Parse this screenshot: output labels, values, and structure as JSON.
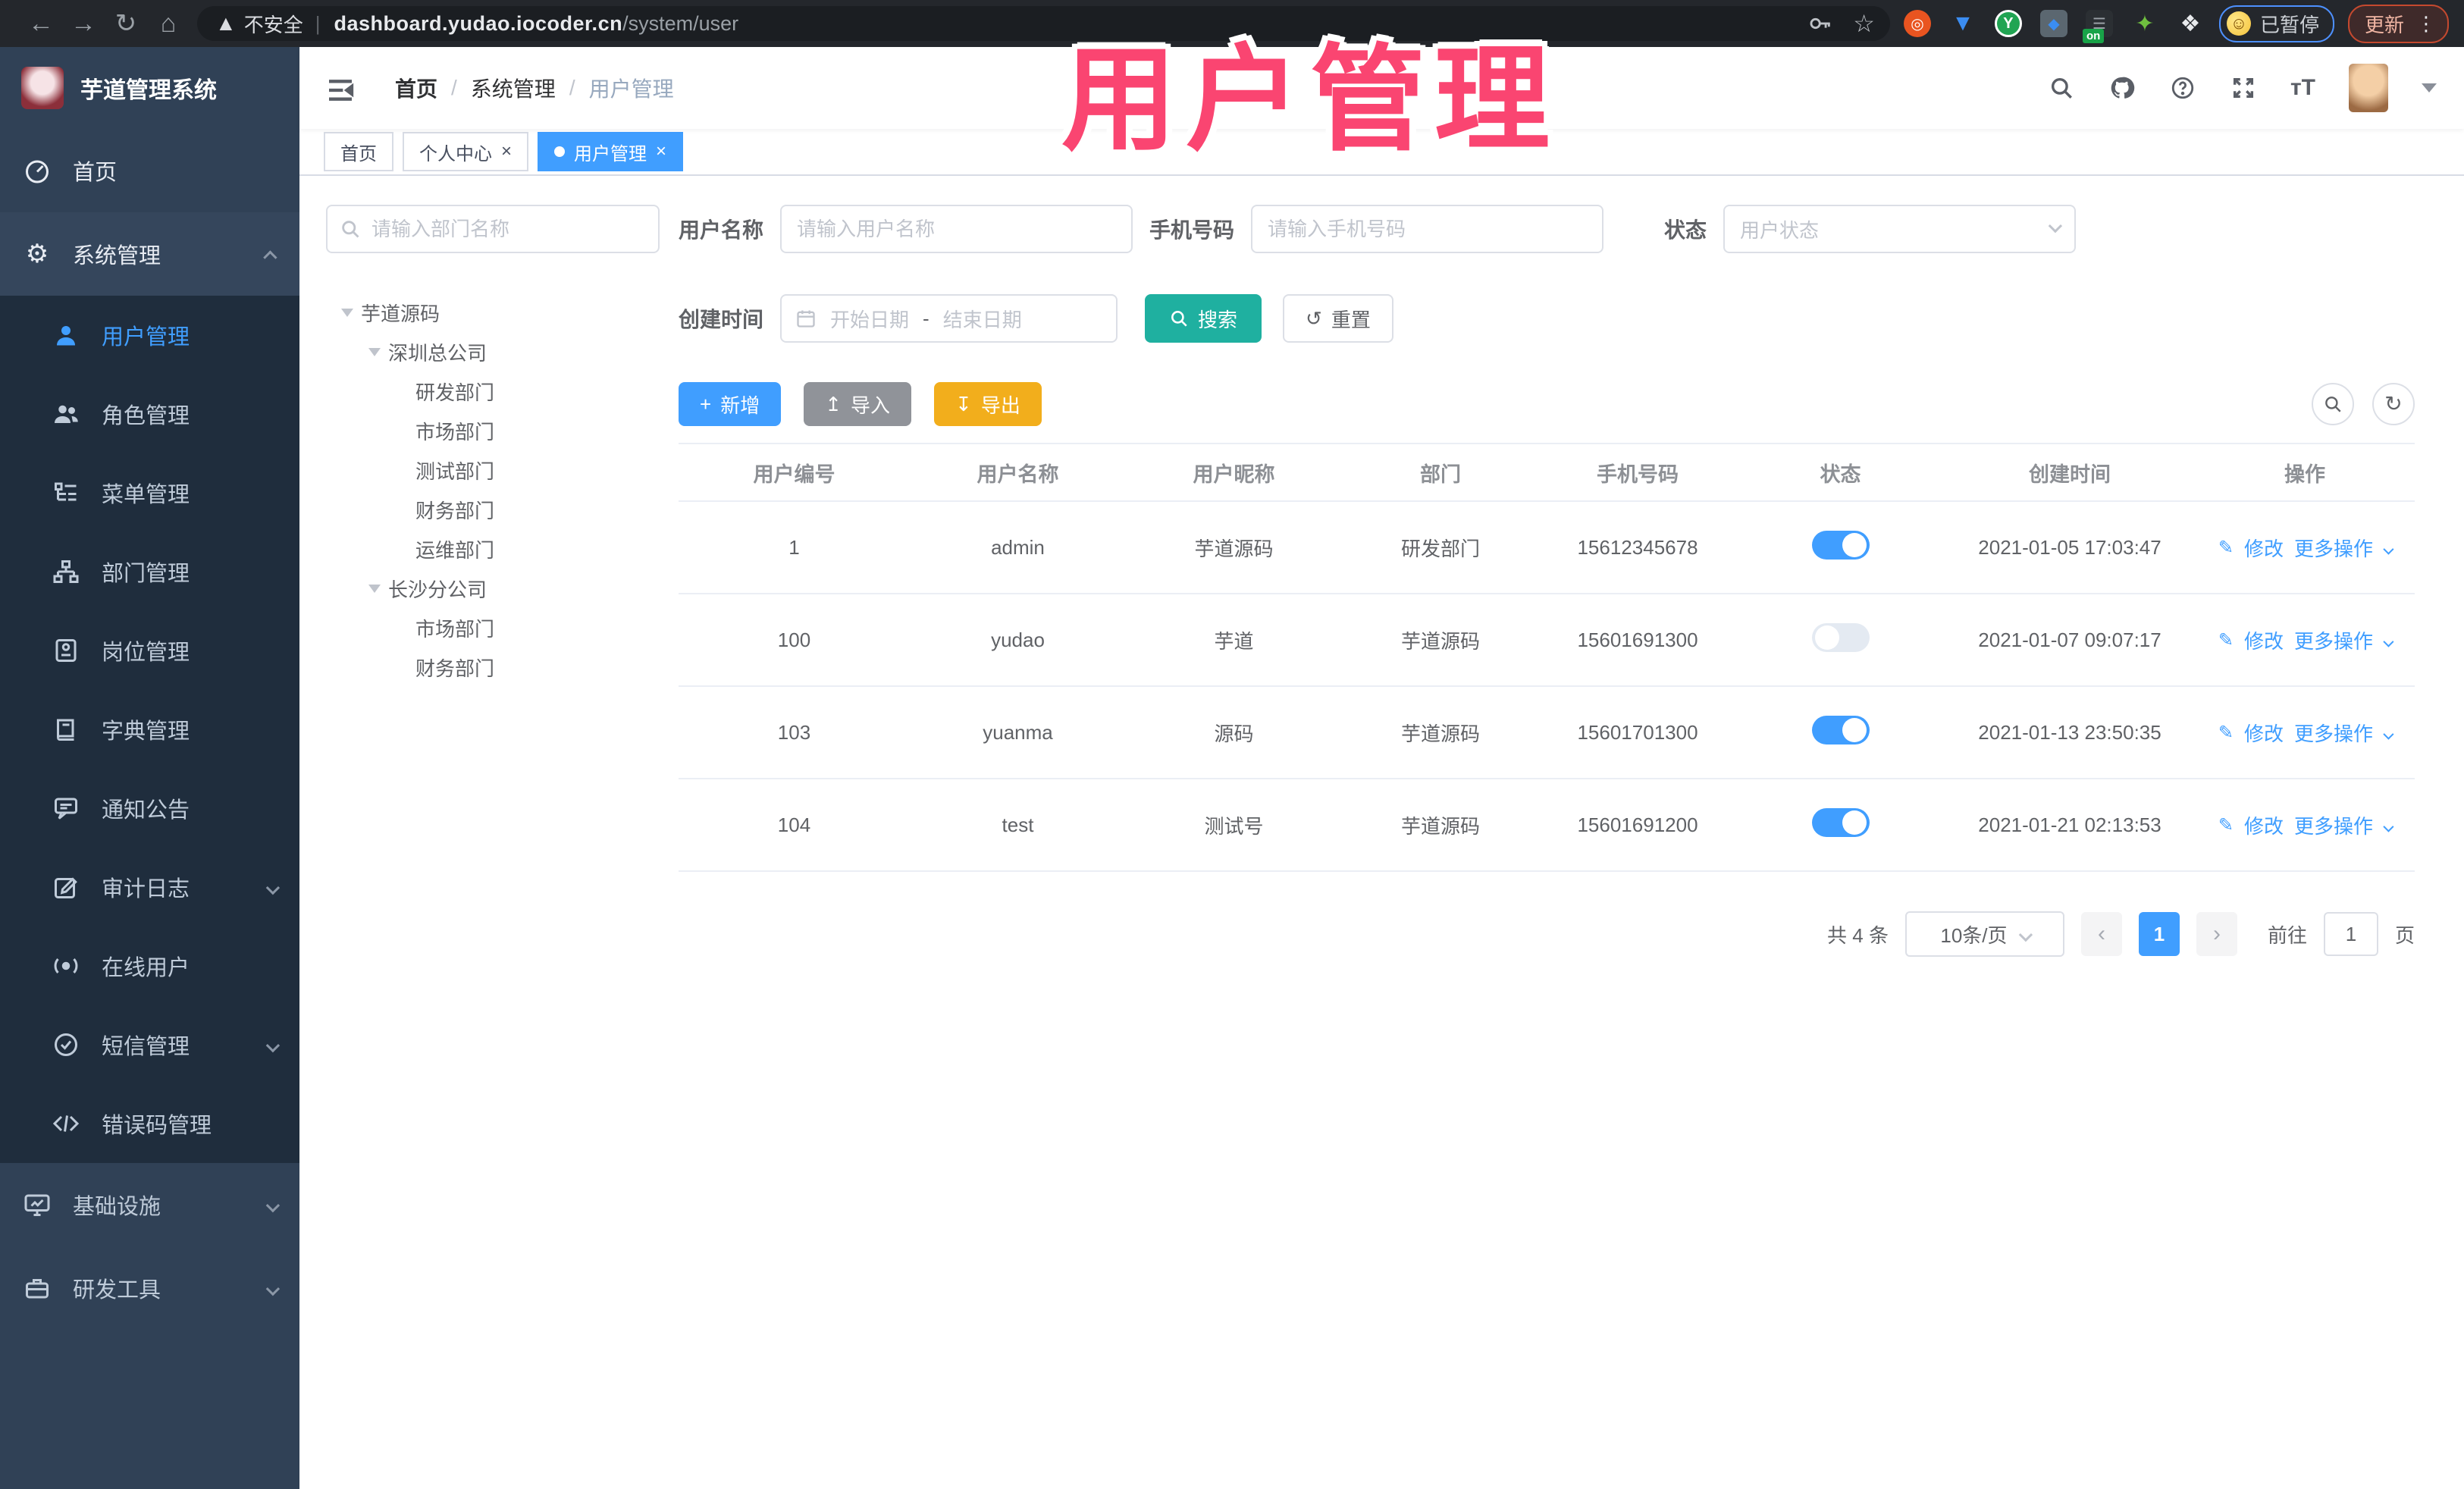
{
  "browser": {
    "security_label": "不安全",
    "url_host": "dashboard.yudao.iocoder.cn",
    "url_path": "/system/user",
    "paused_label": "已暂停",
    "update_label": "更新"
  },
  "overlay_title": "用户管理",
  "colors": {
    "primary": "#409eff",
    "search_teal": "#1fb0a0",
    "export_yellow": "#f2ae1c",
    "import_gray": "#909399",
    "overlay_pink": "#fa4571",
    "sidebar_bg": "#304156",
    "submenu_bg": "#1f2d3d"
  },
  "sidebar": {
    "logo_title": "芋道管理系统",
    "items": [
      {
        "label": "首页"
      },
      {
        "label": "系统管理"
      },
      {
        "label": "用户管理"
      },
      {
        "label": "角色管理"
      },
      {
        "label": "菜单管理"
      },
      {
        "label": "部门管理"
      },
      {
        "label": "岗位管理"
      },
      {
        "label": "字典管理"
      },
      {
        "label": "通知公告"
      },
      {
        "label": "审计日志"
      },
      {
        "label": "在线用户"
      },
      {
        "label": "短信管理"
      },
      {
        "label": "错误码管理"
      },
      {
        "label": "基础设施"
      },
      {
        "label": "研发工具"
      }
    ]
  },
  "header": {
    "breadcrumb": [
      "首页",
      "系统管理",
      "用户管理"
    ]
  },
  "tabs": [
    {
      "label": "首页"
    },
    {
      "label": "个人中心"
    },
    {
      "label": "用户管理"
    }
  ],
  "filters": {
    "dept_search_placeholder": "请输入部门名称",
    "username_label": "用户名称",
    "username_placeholder": "请输入用户名称",
    "mobile_label": "手机号码",
    "mobile_placeholder": "请输入手机号码",
    "status_label": "状态",
    "status_placeholder": "用户状态",
    "create_time_label": "创建时间",
    "date_start_placeholder": "开始日期",
    "date_separator": "-",
    "date_end_placeholder": "结束日期",
    "search_label": "搜索",
    "reset_label": "重置"
  },
  "tree": {
    "nodes": [
      {
        "label": "芋道源码"
      },
      {
        "label": "深圳总公司"
      },
      {
        "label": "研发部门"
      },
      {
        "label": "市场部门"
      },
      {
        "label": "测试部门"
      },
      {
        "label": "财务部门"
      },
      {
        "label": "运维部门"
      },
      {
        "label": "长沙分公司"
      },
      {
        "label": "市场部门"
      },
      {
        "label": "财务部门"
      }
    ]
  },
  "toolbar": {
    "add_label": "新增",
    "import_label": "导入",
    "export_label": "导出"
  },
  "table": {
    "columns": [
      "用户编号",
      "用户名称",
      "用户昵称",
      "部门",
      "手机号码",
      "状态",
      "创建时间",
      "操作"
    ],
    "ops": {
      "edit": "修改",
      "more": "更多操作"
    },
    "rows": [
      {
        "id": "1",
        "username": "admin",
        "nickname": "芋道源码",
        "dept": "研发部门",
        "mobile": "15612345678",
        "status": "on",
        "created_at": "2021-01-05 17:03:47"
      },
      {
        "id": "100",
        "username": "yudao",
        "nickname": "芋道",
        "dept": "芋道源码",
        "mobile": "15601691300",
        "status": "off",
        "created_at": "2021-01-07 09:07:17"
      },
      {
        "id": "103",
        "username": "yuanma",
        "nickname": "源码",
        "dept": "芋道源码",
        "mobile": "15601701300",
        "status": "on",
        "created_at": "2021-01-13 23:50:35"
      },
      {
        "id": "104",
        "username": "test",
        "nickname": "测试号",
        "dept": "芋道源码",
        "mobile": "15601691200",
        "status": "on",
        "created_at": "2021-01-21 02:13:53"
      }
    ]
  },
  "pagination": {
    "total_label": "共 4 条",
    "page_size_label": "10条/页",
    "current_page": "1",
    "goto_label": "前往",
    "goto_value": "1",
    "page_unit": "页"
  }
}
